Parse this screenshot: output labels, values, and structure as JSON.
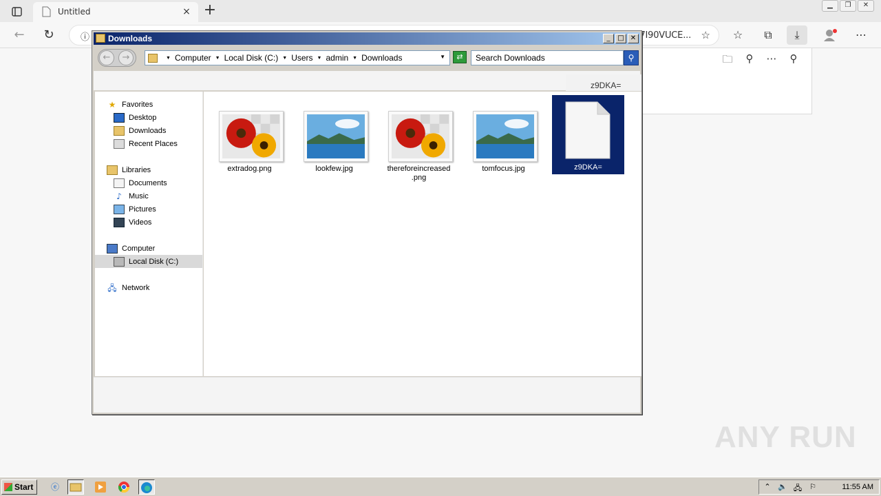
{
  "browser": {
    "tab_title": "Untitled",
    "tab_close": "×",
    "new_tab": "+",
    "address_text": "7I90VUCE...",
    "download_item_name": "z9DKA="
  },
  "explorer": {
    "title": "Downloads",
    "breadcrumb": [
      "Computer",
      "Local Disk (C:)",
      "Users",
      "admin",
      "Downloads"
    ],
    "search_placeholder": "Search Downloads",
    "sidebar": {
      "favorites": {
        "label": "Favorites",
        "items": [
          "Desktop",
          "Downloads",
          "Recent Places"
        ]
      },
      "libraries": {
        "label": "Libraries",
        "items": [
          "Documents",
          "Music",
          "Pictures",
          "Videos"
        ]
      },
      "computer": {
        "label": "Computer",
        "items": [
          "Local Disk (C:)"
        ]
      },
      "network": {
        "label": "Network"
      }
    },
    "files": [
      {
        "name": "extradog.png",
        "kind": "flower-image"
      },
      {
        "name": "lookfew.jpg",
        "kind": "landscape-image"
      },
      {
        "name": "thereforeincreased.png",
        "kind": "flower-image",
        "label_line1": "thereforeincreased",
        "label_line2": ".png"
      },
      {
        "name": "tomfocus.jpg",
        "kind": "landscape-image"
      },
      {
        "name": "z9DKA=",
        "kind": "blank-file",
        "selected": true
      }
    ]
  },
  "taskbar": {
    "start_label": "Start",
    "clock": "11:55 AM"
  },
  "watermark": "ANY RUN",
  "colors": {
    "title_gradient_start": "#0a246a",
    "title_gradient_end": "#a6caf0",
    "selection": "#0a246a"
  }
}
